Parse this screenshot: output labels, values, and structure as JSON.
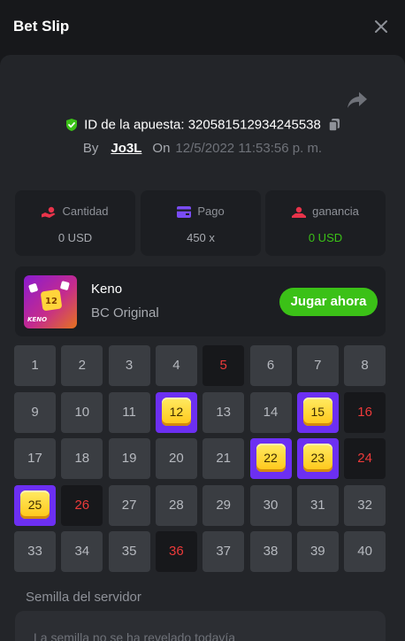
{
  "header": {
    "title": "Bet Slip"
  },
  "bet": {
    "id_label": "ID de la apuesta:",
    "id_value": "320581512934245538",
    "by_label": "By",
    "user": "Jo3L",
    "on_label": "On",
    "date": "12/5/2022 11:53:56 p. m."
  },
  "stats": {
    "amount_label": "Cantidad",
    "amount_value": "0 USD",
    "payout_label": "Pago",
    "payout_value": "450 x",
    "profit_label": "ganancia",
    "profit_value": "0 USD"
  },
  "game": {
    "name": "Keno",
    "provider": "BC Original",
    "play_label": "Jugar ahora",
    "thumb_text": "KENO"
  },
  "grid": [
    [
      "1",
      "normal"
    ],
    [
      "2",
      "normal"
    ],
    [
      "3",
      "normal"
    ],
    [
      "4",
      "normal"
    ],
    [
      "5",
      "miss"
    ],
    [
      "6",
      "normal"
    ],
    [
      "7",
      "normal"
    ],
    [
      "8",
      "normal"
    ],
    [
      "9",
      "normal"
    ],
    [
      "10",
      "normal"
    ],
    [
      "11",
      "normal"
    ],
    [
      "12",
      "hit"
    ],
    [
      "13",
      "normal"
    ],
    [
      "14",
      "normal"
    ],
    [
      "15",
      "hit"
    ],
    [
      "16",
      "miss"
    ],
    [
      "17",
      "normal"
    ],
    [
      "18",
      "normal"
    ],
    [
      "19",
      "normal"
    ],
    [
      "20",
      "normal"
    ],
    [
      "21",
      "normal"
    ],
    [
      "22",
      "hit"
    ],
    [
      "23",
      "hit"
    ],
    [
      "24",
      "miss"
    ],
    [
      "25",
      "hit"
    ],
    [
      "26",
      "miss"
    ],
    [
      "27",
      "normal"
    ],
    [
      "28",
      "normal"
    ],
    [
      "29",
      "normal"
    ],
    [
      "30",
      "normal"
    ],
    [
      "31",
      "normal"
    ],
    [
      "32",
      "normal"
    ],
    [
      "33",
      "normal"
    ],
    [
      "34",
      "normal"
    ],
    [
      "35",
      "normal"
    ],
    [
      "36",
      "miss"
    ],
    [
      "37",
      "normal"
    ],
    [
      "38",
      "normal"
    ],
    [
      "39",
      "normal"
    ],
    [
      "40",
      "normal"
    ]
  ],
  "seed": {
    "label": "Semilla del servidor",
    "value": "La semilla no se ha revelado todavía"
  },
  "colors": {
    "accent_green": "#3bc117",
    "hit_purple": "#6c2ff2",
    "miss_red": "#ed3a3a"
  }
}
